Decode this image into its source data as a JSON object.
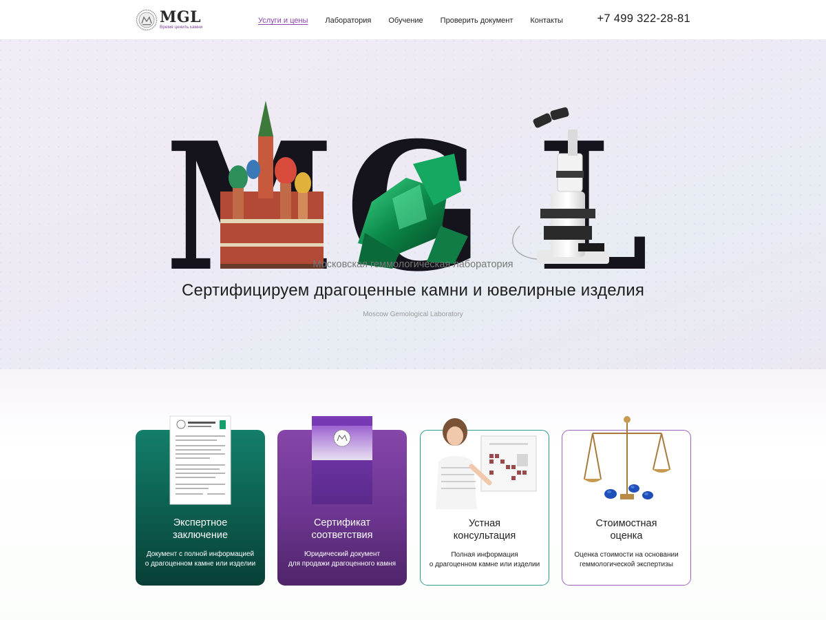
{
  "header": {
    "logo_word": "MGL",
    "logo_tagline": "Время ценить камни",
    "nav": [
      {
        "label": "Услуги и цены",
        "active": true
      },
      {
        "label": "Лаборатория",
        "active": false
      },
      {
        "label": "Обучение",
        "active": false
      },
      {
        "label": "Проверить документ",
        "active": false
      },
      {
        "label": "Контакты",
        "active": false
      }
    ],
    "phone": "+7 499 322-28-81"
  },
  "hero": {
    "letters": [
      "M",
      "G",
      "L"
    ],
    "subtitle": "Московская геммологическая лаборатория",
    "title": "Сертифицируем драгоценные камни и ювелирные изделия",
    "english": "Moscow Gemological Laboratory",
    "images": [
      "st-basils-cathedral",
      "emerald-crystal",
      "microscope"
    ]
  },
  "services": [
    {
      "title": "Экспертное\nзаключение",
      "description": "Документ с полной информацией\nо драгоценном камне или изделии",
      "image": "expert-report-document",
      "style": "green"
    },
    {
      "title": "Сертификат\nсоответствия",
      "description": "Юридический документ\nдля продажи драгоценного камня",
      "image": "certificate-folder",
      "style": "purple"
    },
    {
      "title": "Устная\nконсультация",
      "description": "Полная информация\nо драгоценном камне или изделии",
      "image": "woman-with-chart",
      "style": "outline-teal"
    },
    {
      "title": "Стоимостная\nоценка",
      "description": "Оценка стоимости на основании\nгеммологической экспертизы",
      "image": "scales-with-sapphires",
      "style": "outline-purple"
    }
  ],
  "colors": {
    "accent_purple": "#8a44b0",
    "card_green": "#0c5d4e",
    "card_purple": "#6c3590",
    "outline_teal": "#2a9c8f",
    "outline_purple": "#9a62bf"
  }
}
